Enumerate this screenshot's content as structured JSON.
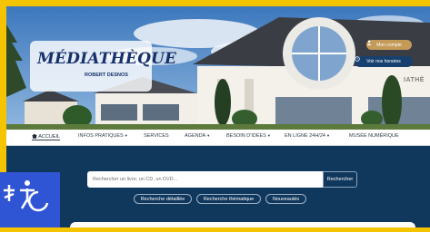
{
  "logo": {
    "title": "MÉDIATHÈQUE",
    "subtitle": "ROBERT DESNOS"
  },
  "header_buttons": {
    "account": "Mon compte",
    "hours": "Voir nos horaires",
    "account_icon": "user-icon",
    "hours_icon": "clock-icon"
  },
  "building_sign": "IATHÈ",
  "nav": {
    "items": [
      {
        "label": "ACCUEIL",
        "icon": "home-icon",
        "dropdown": false,
        "active": true
      },
      {
        "label": "INFOS PRATIQUES",
        "dropdown": true
      },
      {
        "label": "SERVICES",
        "dropdown": false
      },
      {
        "label": "AGENDA",
        "dropdown": true
      },
      {
        "label": "BESOIN D'IDÉES",
        "dropdown": true
      },
      {
        "label": "EN LIGNE 24H/24",
        "dropdown": true
      },
      {
        "label": "MUSÉE NUMÉRIQUE",
        "dropdown": false
      }
    ]
  },
  "search": {
    "placeholder": "Rechercher un livre, un CD, un DVD...",
    "button": "Rechercher",
    "links": [
      "Recherche détaillée",
      "Recherche thématique",
      "Nouveautés"
    ]
  },
  "colors": {
    "accent_gold": "#c49a58",
    "navy": "#10375c",
    "border_yellow": "#f4c400",
    "accessibility_blue": "#2f55d4"
  }
}
